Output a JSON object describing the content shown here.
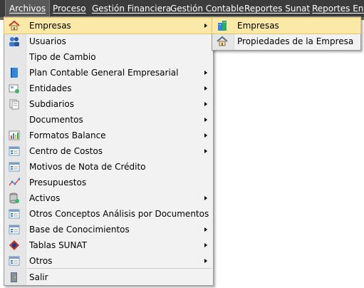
{
  "menubar": {
    "items": [
      {
        "label": "Archivos"
      },
      {
        "label": "Proceso"
      },
      {
        "label": "Gestión Financiera"
      },
      {
        "label": "Gestión Contable"
      },
      {
        "label": "Reportes Sunat"
      },
      {
        "label": "Reportes Ente"
      }
    ]
  },
  "archivos_menu": {
    "items": [
      {
        "label": "Empresas",
        "icon": "house-icon",
        "submenu": true
      },
      {
        "label": "Usuarios",
        "icon": "users-icon",
        "submenu": false
      },
      {
        "label": "Tipo de Cambio",
        "icon": "none",
        "submenu": false
      },
      {
        "label": "Plan Contable General Empresarial",
        "icon": "book-icon",
        "submenu": true
      },
      {
        "label": "Entidades",
        "icon": "entities-icon",
        "submenu": true
      },
      {
        "label": "Subdiarios",
        "icon": "pages-icon",
        "submenu": true
      },
      {
        "label": "Documentos",
        "icon": "none",
        "submenu": true
      },
      {
        "label": "Formatos Balance",
        "icon": "bar-chart-icon",
        "submenu": true
      },
      {
        "label": "Centro de Costos",
        "icon": "form-icon",
        "submenu": true
      },
      {
        "label": "Motivos de Nota de Crédito",
        "icon": "form-icon",
        "submenu": false
      },
      {
        "label": "Presupuestos",
        "icon": "line-chart-icon",
        "submenu": false
      },
      {
        "label": "Activos",
        "icon": "database-icon",
        "submenu": true
      },
      {
        "label": "Otros Conceptos Análisis por Documentos",
        "icon": "form-icon",
        "submenu": false
      },
      {
        "label": "Base de Conocimientos",
        "icon": "form-icon",
        "submenu": true
      },
      {
        "label": "Tablas SUNAT",
        "icon": "sunat-logo-icon",
        "submenu": true
      },
      {
        "label": "Otros",
        "icon": "form-icon",
        "submenu": true
      },
      {
        "label": "Salir",
        "icon": "exit-door-icon",
        "submenu": false
      }
    ]
  },
  "empresas_submenu": {
    "items": [
      {
        "label": "Empresas",
        "icon": "buildings-icon"
      },
      {
        "label": "Propiedades de la Empresa",
        "icon": "house-icon"
      }
    ]
  },
  "colors": {
    "menubar_bg": "#3c3c3c",
    "menu_bg": "#f2f2f2",
    "highlight": "#fbe9a7",
    "highlight_border": "#e5c365"
  }
}
